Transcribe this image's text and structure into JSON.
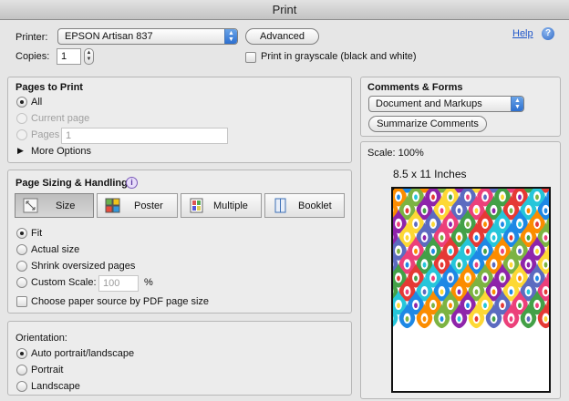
{
  "window": {
    "title": "Print"
  },
  "printer": {
    "label": "Printer:",
    "selected": "EPSON Artisan 837",
    "advanced_label": "Advanced",
    "help_label": "Help",
    "help_icon": "question-mark-icon"
  },
  "copies": {
    "label": "Copies:",
    "value": "1",
    "grayscale_label": "Print in grayscale (black and white)",
    "grayscale_checked": false
  },
  "pages_to_print": {
    "title": "Pages to Print",
    "all_label": "All",
    "current_label": "Current page",
    "pages_label": "Pages",
    "pages_value": "1",
    "more_options_label": "More Options",
    "selected": "all"
  },
  "sizing": {
    "title": "Page Sizing & Handling",
    "info_icon": "info-icon",
    "segments": [
      {
        "label": "Size",
        "icon": "size-icon",
        "selected": true
      },
      {
        "label": "Poster",
        "icon": "poster-icon",
        "selected": false
      },
      {
        "label": "Multiple",
        "icon": "multiple-icon",
        "selected": false
      },
      {
        "label": "Booklet",
        "icon": "booklet-icon",
        "selected": false
      }
    ],
    "fit_label": "Fit",
    "actual_label": "Actual size",
    "shrink_label": "Shrink oversized pages",
    "custom_label": "Custom Scale:",
    "custom_value": "100",
    "percent_label": "%",
    "paper_source_label": "Choose paper source by PDF page size",
    "selected": "fit"
  },
  "orientation": {
    "title": "Orientation:",
    "auto_label": "Auto portrait/landscape",
    "portrait_label": "Portrait",
    "landscape_label": "Landscape",
    "selected": "auto"
  },
  "comments": {
    "title": "Comments & Forms",
    "selected": "Document and Markups",
    "summarize_label": "Summarize Comments"
  },
  "preview": {
    "scale_label": "Scale: 100%",
    "paper_size_label": "8.5 x 11 Inches",
    "colors": [
      "#e53935",
      "#fb8c00",
      "#fdd835",
      "#43a047",
      "#1e88e5",
      "#8e24aa",
      "#ec407a",
      "#26c6da",
      "#7cb342",
      "#5c6bc0"
    ]
  }
}
